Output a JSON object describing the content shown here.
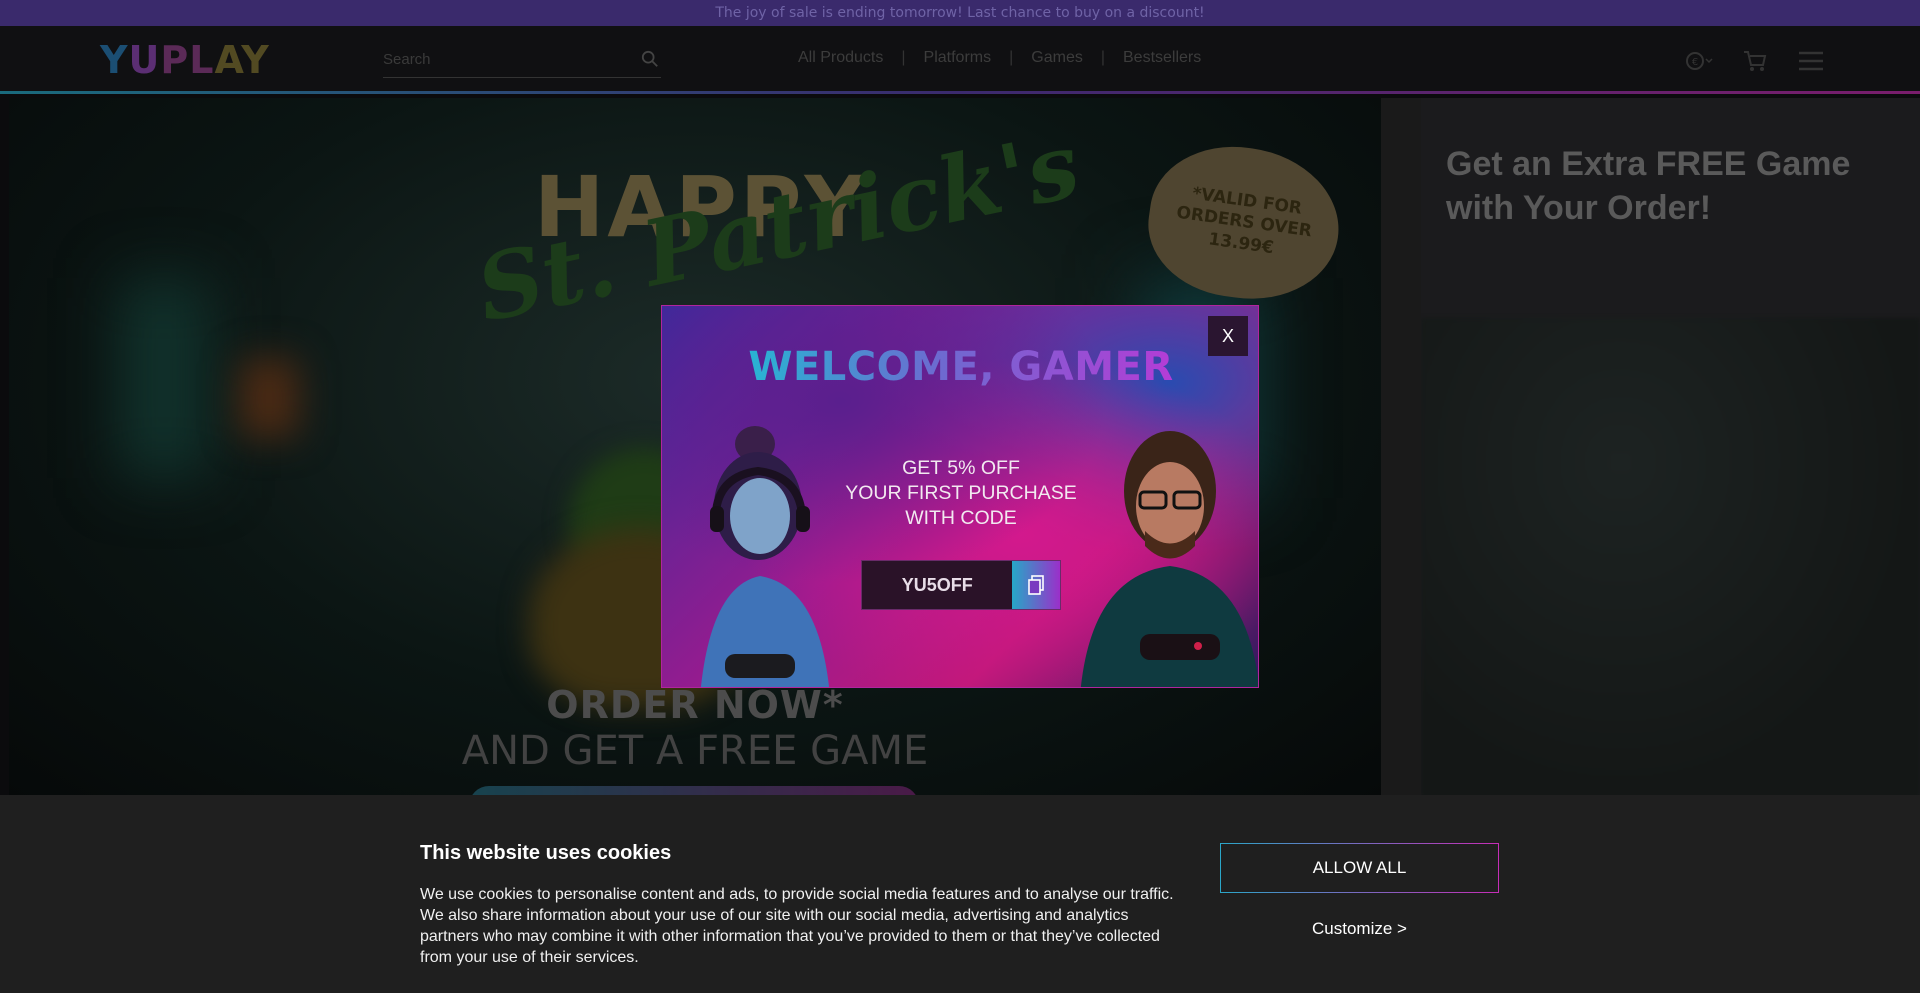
{
  "announcement": {
    "text": "The joy of sale is ending tomorrow! Last chance to buy on a discount!"
  },
  "header": {
    "logo_parts": [
      "Y",
      "U",
      "PL",
      "AY"
    ],
    "search": {
      "placeholder": "Search"
    },
    "nav": [
      "All Products",
      "Platforms",
      "Games",
      "Bestsellers"
    ],
    "icons": [
      "currency-icon",
      "cart-icon",
      "menu-icon"
    ]
  },
  "hero": {
    "happy": "HAPPY",
    "st_patricks": "St. Patrick's",
    "valid_note": "*VALID FOR ORDERS OVER 13.99€",
    "order_now": "ORDER NOW*",
    "free_game": "AND GET A FREE GAME"
  },
  "right_panel": {
    "title": "Get an Extra FREE Game with Your Order!"
  },
  "modal": {
    "close_label": "X",
    "title": "WELCOME, GAMER",
    "promo_lines": [
      "GET 5% OFF",
      "YOUR FIRST PURCHASE",
      "WITH CODE"
    ],
    "code": "YU5OFF"
  },
  "cookie": {
    "title": "This website uses cookies",
    "body": "We use cookies to personalise content and ads, to provide social media features and to analyse our traffic. We also share information about your use of our site with our social media, advertising and analytics partners who may combine it with other information that you’ve provided to them or that they’ve collected from your use of their services.",
    "allow_all": "ALLOW ALL",
    "customize": "Customize >"
  },
  "colors": {
    "accent_cyan": "#28b4d3",
    "accent_magenta": "#c62db7",
    "announce_bg": "#3a2a6c",
    "cookie_bg": "#1f1f1f"
  }
}
